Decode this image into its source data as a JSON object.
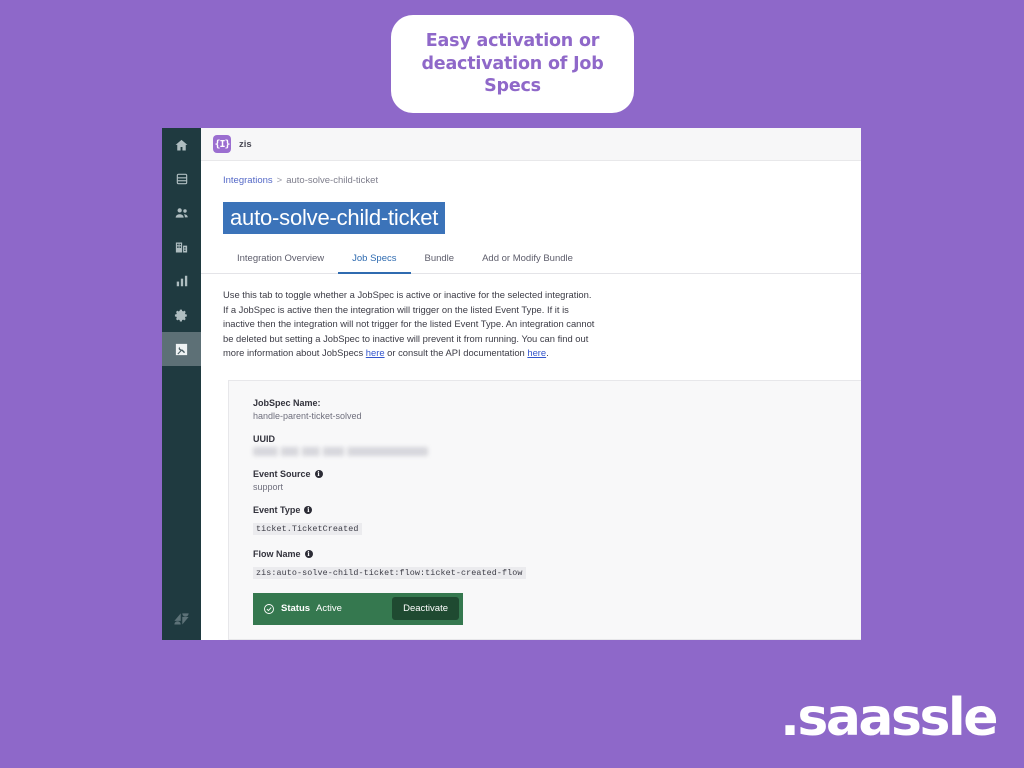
{
  "callout": {
    "text": "Easy activation or deactivation of Job Specs"
  },
  "colors": {
    "background_purple": "#8e68c9",
    "callout_text": "#8f68c9",
    "sidebar": "#1f3a40",
    "sidebar_active": "#5d7076",
    "title_highlight": "#3b73b9",
    "tab_active": "#2f6bb0",
    "status_green": "#35784f",
    "deactivate_button": "#1f4a31",
    "link": "#3355cc",
    "card_background": "#f8f8f9"
  },
  "sidebar": {
    "items": [
      {
        "name": "home",
        "icon": "home-icon",
        "active": false
      },
      {
        "name": "objects",
        "icon": "database-icon",
        "active": false
      },
      {
        "name": "people",
        "icon": "people-icon",
        "active": false
      },
      {
        "name": "organizations",
        "icon": "building-icon",
        "active": false
      },
      {
        "name": "reporting",
        "icon": "bar-chart-icon",
        "active": false
      },
      {
        "name": "settings",
        "icon": "gear-icon",
        "active": false
      },
      {
        "name": "integrations",
        "icon": "wrench-icon",
        "active": true
      }
    ],
    "brand": {
      "icon": "zendesk-logo-icon"
    }
  },
  "topbar": {
    "app_mark": "{I}",
    "app_name": "zis"
  },
  "breadcrumb": {
    "root": "Integrations",
    "separator": ">",
    "current": "auto-solve-child-ticket"
  },
  "page": {
    "title": "auto-solve-child-ticket"
  },
  "tabs": [
    {
      "label": "Integration Overview",
      "active": false
    },
    {
      "label": "Job Specs",
      "active": true
    },
    {
      "label": "Bundle",
      "active": false
    },
    {
      "label": "Add or Modify Bundle",
      "active": false
    }
  ],
  "description": {
    "part1": "Use this tab to toggle whether a JobSpec is active or inactive for the selected integration. If a JobSpec is active then the integration will trigger on the listed Event Type. If it is inactive then the integration will not trigger for the listed Event Type. An integration cannot be deleted but setting a JobSpec to inactive will prevent it from running. You can find out more information about JobSpecs ",
    "link1": "here",
    "part2": " or consult the API documentation ",
    "link2": "here",
    "part3": "."
  },
  "jobspec": {
    "name_label": "JobSpec Name:",
    "name_value": "handle-parent-ticket-solved",
    "uuid_label": "UUID",
    "uuid_value": "",
    "event_source_label": "Event Source",
    "event_source_value": "support",
    "event_type_label": "Event Type",
    "event_type_value": "ticket.TicketCreated",
    "flow_name_label": "Flow Name",
    "flow_name_value": "zis:auto-solve-child-ticket:flow:ticket-created-flow",
    "info_glyph": "i"
  },
  "status": {
    "icon": "check-circle-icon",
    "label": "Status",
    "value": "Active",
    "action_label": "Deactivate"
  },
  "watermark": {
    "text": ".saassle"
  }
}
